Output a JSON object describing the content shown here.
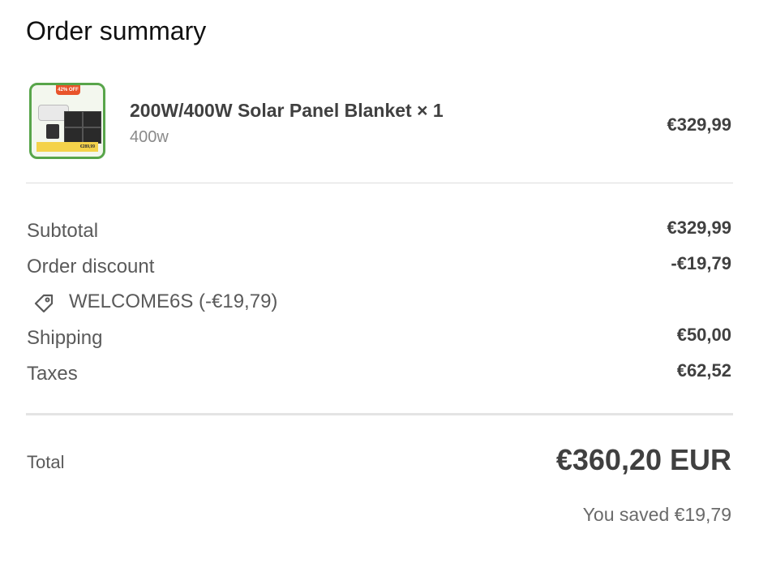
{
  "header": {
    "title": "Order summary"
  },
  "product": {
    "name": "200W/400W Solar Panel Blanket × 1",
    "variant": "400w",
    "price": "€329,99",
    "thumbnail": {
      "badge": "42% OFF",
      "price_tag": "€289,99"
    }
  },
  "lines": {
    "subtotal": {
      "label": "Subtotal",
      "value": "€329,99"
    },
    "discount": {
      "label": "Order discount",
      "value": "-€19,79"
    },
    "discount_code": {
      "icon": "tag-icon",
      "text": "WELCOME6S (-€19,79)"
    },
    "shipping": {
      "label": "Shipping",
      "value": "€50,00"
    },
    "taxes": {
      "label": "Taxes",
      "value": "€62,52"
    }
  },
  "total": {
    "label": "Total",
    "value": "€360,20 EUR",
    "saved": "You saved €19,79"
  },
  "colors": {
    "thumbnail_border": "#58a54a",
    "badge": "#e8532a",
    "price_bar": "#f4d24a"
  }
}
